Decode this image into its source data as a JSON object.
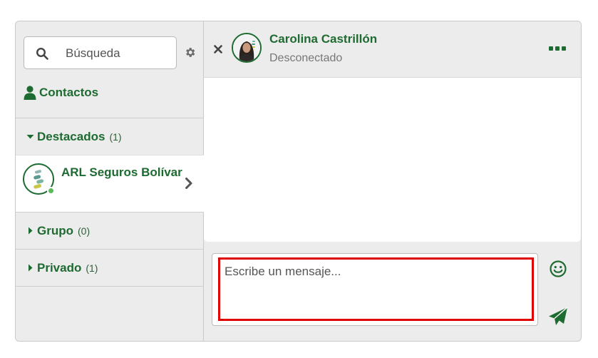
{
  "search": {
    "placeholder": "Búsqueda"
  },
  "contacts_link": {
    "label": "Contactos"
  },
  "sections": {
    "destacados": {
      "label": "Destacados",
      "count": "(1)"
    },
    "grupo": {
      "label": "Grupo",
      "count": "(0)"
    },
    "privado": {
      "label": "Privado",
      "count": "(1)"
    }
  },
  "featured_contact": {
    "name": "ARL Seguros Bolívar",
    "presence": "online"
  },
  "chat": {
    "name": "Carolina Castrillón",
    "status": "Desconectado"
  },
  "composer": {
    "placeholder": "Escribe un mensaje..."
  },
  "colors": {
    "brand_green": "#1e6b31",
    "online": "#5cb85c",
    "highlight_red": "#e00000"
  },
  "icons": [
    "search-icon",
    "gear-icon",
    "user-icon",
    "caret-down-icon",
    "caret-right-icon",
    "chevron-right-icon",
    "close-icon",
    "more-icon",
    "emoji-icon",
    "send-icon"
  ]
}
